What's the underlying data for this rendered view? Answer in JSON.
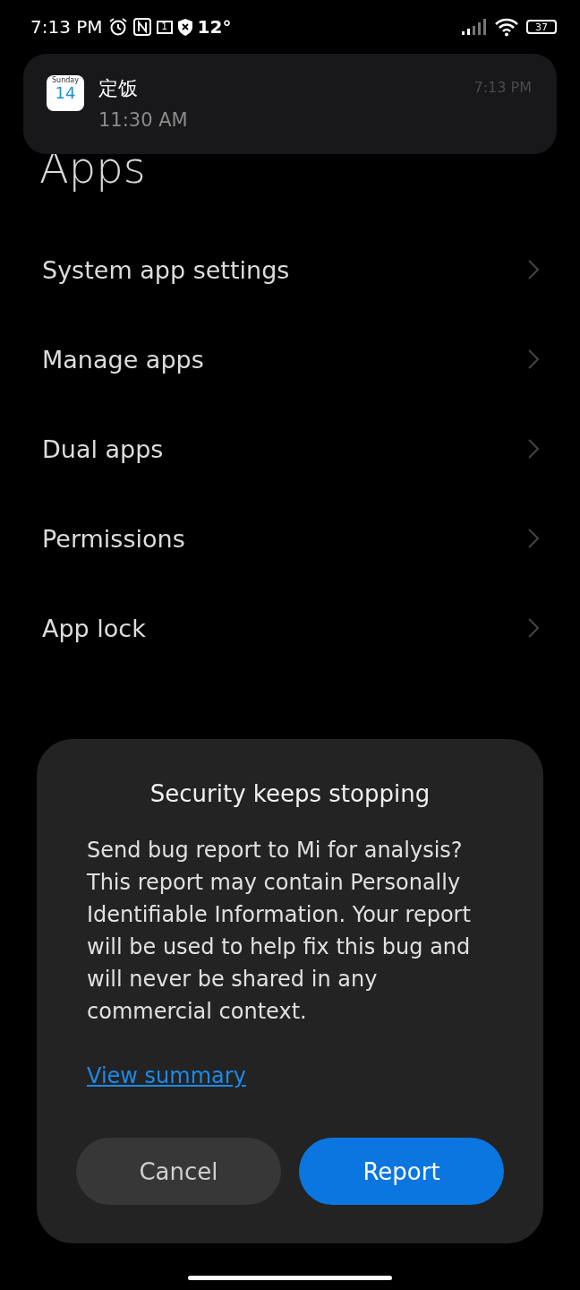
{
  "status_bar": {
    "time": "7:13 PM",
    "temperature": "12°",
    "sim_slot": "1",
    "battery": "37"
  },
  "notification": {
    "icon_day": "Sunday",
    "icon_date": "14",
    "title": "定饭",
    "subtitle": "11:30 AM",
    "time": "7:13 PM"
  },
  "page": {
    "title": "Apps"
  },
  "menu_items": [
    {
      "label": "System app settings"
    },
    {
      "label": "Manage apps"
    },
    {
      "label": "Dual apps"
    },
    {
      "label": "Permissions"
    },
    {
      "label": "App lock"
    }
  ],
  "dialog": {
    "title": "Security keeps stopping",
    "message": "Send bug report to Mi for analysis? This report may contain Personally Identifiable Information. Your report will be used to help fix this bug and will never be shared in any commercial context.",
    "link": "View summary",
    "buttons": [
      {
        "label": "Cancel",
        "kind": "secondary"
      },
      {
        "label": "Report",
        "kind": "primary"
      }
    ]
  }
}
